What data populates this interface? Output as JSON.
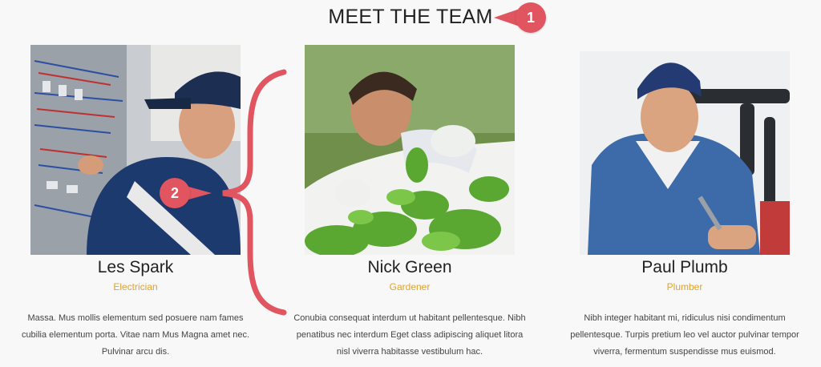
{
  "section": {
    "title": "MEET THE TEAM"
  },
  "callouts": {
    "first": "1",
    "second": "2"
  },
  "team": [
    {
      "name": "Les Spark",
      "role": "Electrician",
      "description": "Massa. Mus mollis elementum sed posuere nam fames cubilia elementum porta. Vitae nam Mus Magna amet nec. Pulvinar arcu dis."
    },
    {
      "name": "Nick Green",
      "role": "Gardener",
      "description": "Conubia consequat interdum ut habitant pellentesque. Nibh penatibus nec interdum Eget class adipiscing aliquet litora nisl viverra habitasse vestibulum hac."
    },
    {
      "name": "Paul Plumb",
      "role": "Plumber",
      "description": "Nibh integer habitant mi, ridiculus nisi condimentum pellentesque. Turpis pretium leo vel auctor pulvinar tempor viverra, fermentum suspendisse mus euismod."
    }
  ],
  "colors": {
    "accent": "#e05560",
    "role_text": "#e0a32e",
    "background": "#f8f8f8"
  }
}
